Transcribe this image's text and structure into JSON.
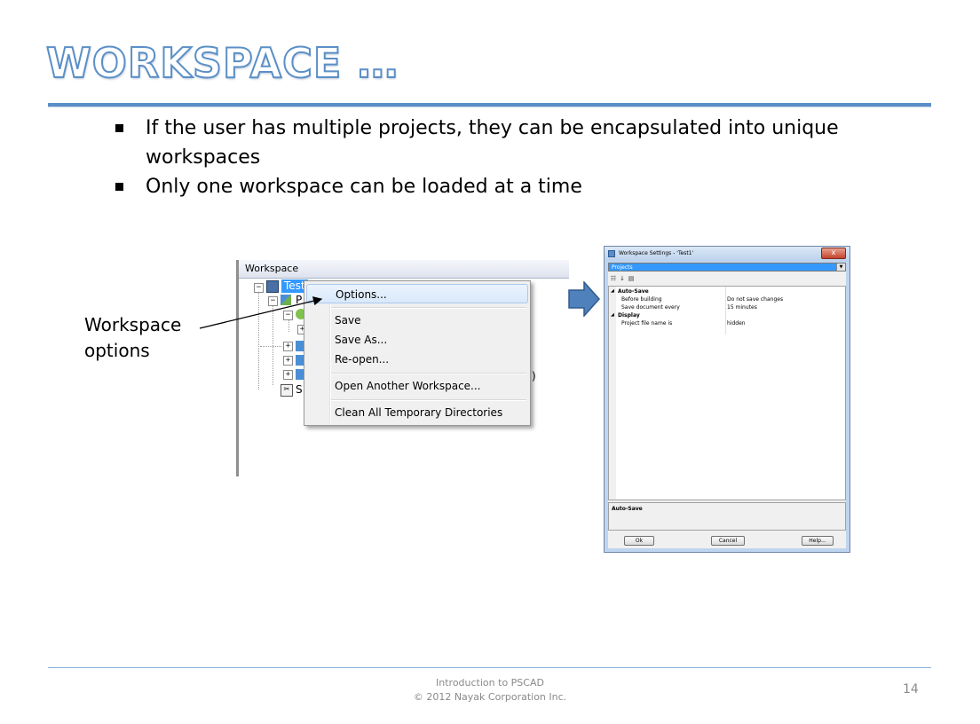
{
  "slide": {
    "title": "WORKSPACE …",
    "bullets": [
      "If the user has multiple projects, they can be encapsulated into unique workspaces",
      "Only one workspace can be loaded at a time"
    ],
    "callout": {
      "line1": "Workspace",
      "line2": "options"
    },
    "footer": {
      "line1": "Introduction to PSCAD",
      "line2": "© 2012 Nayak Corporation Inc."
    },
    "page_number": "14"
  },
  "workspace_panel": {
    "header": "Workspace",
    "tree_root": "Test",
    "tree_partial": {
      "p": "P",
      "s": "S",
      "paren": ")"
    }
  },
  "context_menu": {
    "items": [
      "Options...",
      "Save",
      "Save As...",
      "Re-open...",
      "Open Another Workspace...",
      "Clean All Temporary Directories"
    ],
    "highlighted_index": 0
  },
  "settings_dialog": {
    "title": "Workspace Settings - 'Test1'",
    "close_glyph": "x",
    "selector": "Projects",
    "categories": [
      {
        "name": "Auto-Save",
        "props": [
          {
            "name": "Before building",
            "value": "Do not save changes"
          },
          {
            "name": "Save document every",
            "value": "15 minutes"
          }
        ]
      },
      {
        "name": "Display",
        "props": [
          {
            "name": "Project file name is",
            "value": "hidden"
          }
        ]
      }
    ],
    "description": "Auto-Save",
    "buttons": {
      "ok": "Ok",
      "cancel": "Cancel",
      "help": "Help..."
    }
  },
  "colors": {
    "accent": "#5b8fc7",
    "arrow_fill": "#4f81bd",
    "selection": "#3399ff"
  }
}
